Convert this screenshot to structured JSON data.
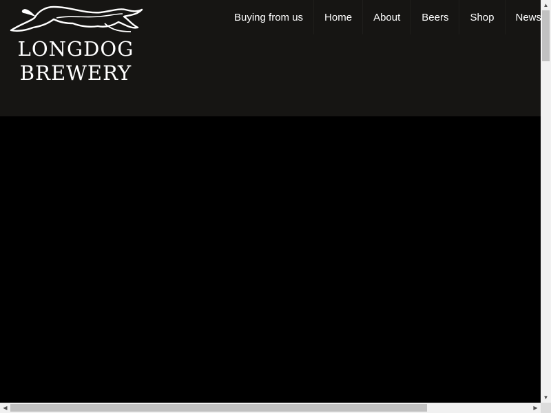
{
  "brand": {
    "line1": "LONGDOG",
    "line2": "BREWERY",
    "logo_icon": "greyhound-logo-icon"
  },
  "nav": {
    "items": [
      {
        "label": "Buying from us"
      },
      {
        "label": "Home"
      },
      {
        "label": "About"
      },
      {
        "label": "Beers"
      },
      {
        "label": "Shop"
      },
      {
        "label": "News"
      }
    ]
  },
  "scrollbars": {
    "up_glyph": "▲",
    "down_glyph": "▼",
    "left_glyph": "◀",
    "right_glyph": "▶"
  },
  "colors": {
    "header_bg": "#161513",
    "page_bg": "#000000",
    "nav_text": "#ffffff"
  }
}
